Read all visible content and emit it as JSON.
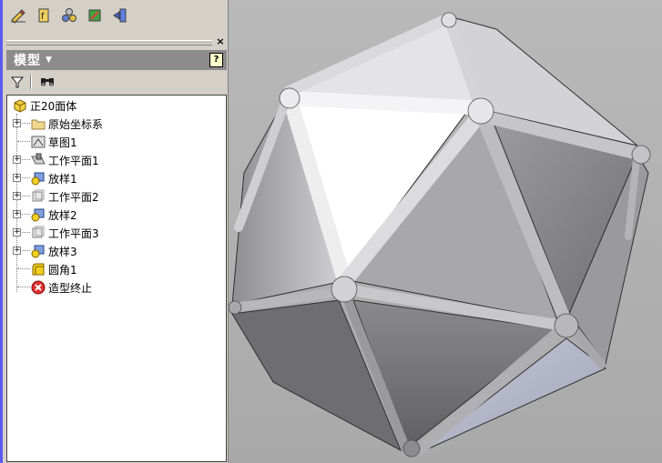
{
  "toolbar": {
    "buttons": [
      {
        "icon": "sketch-icon"
      },
      {
        "icon": "parameters-icon"
      },
      {
        "icon": "components-icon"
      },
      {
        "icon": "color-icon"
      },
      {
        "icon": "return-icon"
      }
    ]
  },
  "browser": {
    "title": "模型",
    "help": "?",
    "close": "×"
  },
  "tree": {
    "root": "正20面体",
    "items": [
      {
        "label": "原始坐标系",
        "icon": "folder-icon",
        "expandable": true
      },
      {
        "label": "草图1",
        "icon": "sketch-icon",
        "expandable": false
      },
      {
        "label": "工作平面1",
        "icon": "workplane-icon",
        "expandable": true
      },
      {
        "label": "放样1",
        "icon": "loft-icon",
        "expandable": true
      },
      {
        "label": "工作平面2",
        "icon": "workplane-icon",
        "expandable": true
      },
      {
        "label": "放样2",
        "icon": "loft-icon",
        "expandable": true
      },
      {
        "label": "工作平面3",
        "icon": "workplane-icon",
        "expandable": true
      },
      {
        "label": "放样3",
        "icon": "loft-icon",
        "expandable": true
      },
      {
        "label": "圆角1",
        "icon": "fillet-icon",
        "expandable": false
      },
      {
        "label": "造型终止",
        "icon": "end-of-part-icon",
        "expandable": false
      }
    ]
  },
  "colors": {
    "header_bg": "#8c8c8c",
    "viewport_bg": "#b0b0b0",
    "accent_edge": "#5a5af0"
  }
}
